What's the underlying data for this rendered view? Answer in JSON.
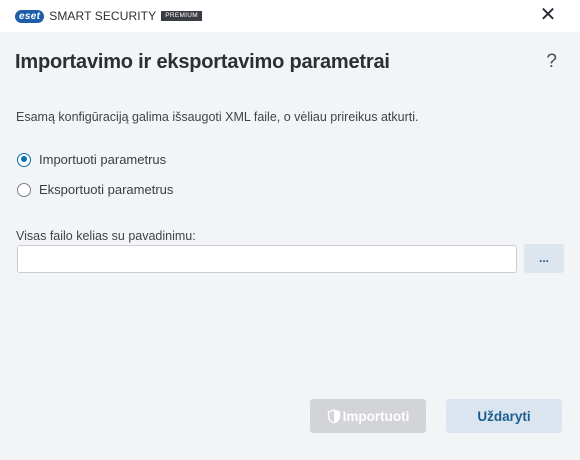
{
  "app": {
    "logo": "eset",
    "product": "SMART SECURITY",
    "edition": "PREMIUM"
  },
  "window": {
    "close_icon": "✕"
  },
  "page": {
    "title": "Importavimo ir eksportavimo parametrai",
    "help_icon": "?",
    "description": "Esamą konfigūraciją galima išsaugoti XML faile, o vėliau prireikus atkurti."
  },
  "options": [
    {
      "label": "Importuoti parametrus",
      "selected": true
    },
    {
      "label": "Eksportuoti parametrus",
      "selected": false
    }
  ],
  "file": {
    "label": "Visas failo kelias su pavadinimu:",
    "value": "",
    "browse_label": "..."
  },
  "buttons": {
    "import_label": "Importuoti",
    "import_enabled": false,
    "close_label": "Uždaryti"
  },
  "colors": {
    "accent": "#0a6fb1",
    "brand": "#1d5ea8",
    "disabled_button": "#d2d4d8",
    "secondary_button": "#dbe5ef"
  }
}
